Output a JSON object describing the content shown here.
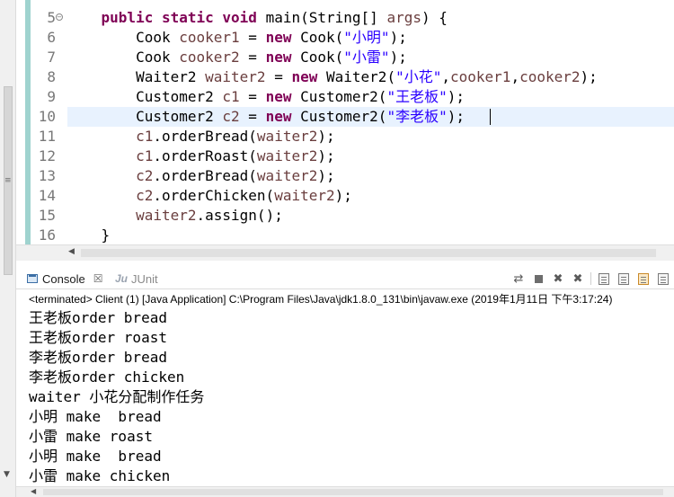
{
  "editor": {
    "lines": [
      {
        "n": "5",
        "tokens": [
          {
            "t": "    ",
            "c": ""
          },
          {
            "t": "public",
            "c": "kw"
          },
          {
            "t": " ",
            "c": ""
          },
          {
            "t": "static",
            "c": "kw"
          },
          {
            "t": " ",
            "c": ""
          },
          {
            "t": "void",
            "c": "kw"
          },
          {
            "t": " main(String[] ",
            "c": ""
          },
          {
            "t": "args",
            "c": "var"
          },
          {
            "t": ") {",
            "c": ""
          }
        ]
      },
      {
        "n": "6",
        "tokens": [
          {
            "t": "        Cook ",
            "c": ""
          },
          {
            "t": "cooker1",
            "c": "var"
          },
          {
            "t": " = ",
            "c": ""
          },
          {
            "t": "new",
            "c": "kw"
          },
          {
            "t": " Cook(",
            "c": ""
          },
          {
            "t": "\"小明\"",
            "c": "str"
          },
          {
            "t": ");",
            "c": ""
          }
        ]
      },
      {
        "n": "7",
        "tokens": [
          {
            "t": "        Cook ",
            "c": ""
          },
          {
            "t": "cooker2",
            "c": "var"
          },
          {
            "t": " = ",
            "c": ""
          },
          {
            "t": "new",
            "c": "kw"
          },
          {
            "t": " Cook(",
            "c": ""
          },
          {
            "t": "\"小雷\"",
            "c": "str"
          },
          {
            "t": ");",
            "c": ""
          }
        ]
      },
      {
        "n": "8",
        "tokens": [
          {
            "t": "        Waiter2 ",
            "c": ""
          },
          {
            "t": "waiter2",
            "c": "var"
          },
          {
            "t": " = ",
            "c": ""
          },
          {
            "t": "new",
            "c": "kw"
          },
          {
            "t": " Waiter2(",
            "c": ""
          },
          {
            "t": "\"小花\"",
            "c": "str"
          },
          {
            "t": ",",
            "c": ""
          },
          {
            "t": "cooker1",
            "c": "var"
          },
          {
            "t": ",",
            "c": ""
          },
          {
            "t": "cooker2",
            "c": "var"
          },
          {
            "t": ");",
            "c": ""
          }
        ]
      },
      {
        "n": "9",
        "tokens": [
          {
            "t": "        Customer2 ",
            "c": ""
          },
          {
            "t": "c1",
            "c": "var"
          },
          {
            "t": " = ",
            "c": ""
          },
          {
            "t": "new",
            "c": "kw"
          },
          {
            "t": " Customer2(",
            "c": ""
          },
          {
            "t": "\"王老板\"",
            "c": "str"
          },
          {
            "t": ");",
            "c": ""
          }
        ]
      },
      {
        "n": "10",
        "tokens": [
          {
            "t": "        Customer2 ",
            "c": ""
          },
          {
            "t": "c2",
            "c": "var"
          },
          {
            "t": " = ",
            "c": ""
          },
          {
            "t": "new",
            "c": "kw"
          },
          {
            "t": " Customer2(",
            "c": ""
          },
          {
            "t": "\"李老板\"",
            "c": "str"
          },
          {
            "t": ");",
            "c": ""
          }
        ]
      },
      {
        "n": "11",
        "tokens": [
          {
            "t": "        ",
            "c": ""
          },
          {
            "t": "c1",
            "c": "var"
          },
          {
            "t": ".orderBread(",
            "c": ""
          },
          {
            "t": "waiter2",
            "c": "var"
          },
          {
            "t": ");",
            "c": ""
          }
        ]
      },
      {
        "n": "12",
        "tokens": [
          {
            "t": "        ",
            "c": ""
          },
          {
            "t": "c1",
            "c": "var"
          },
          {
            "t": ".orderRoast(",
            "c": ""
          },
          {
            "t": "waiter2",
            "c": "var"
          },
          {
            "t": ");",
            "c": ""
          }
        ]
      },
      {
        "n": "13",
        "tokens": [
          {
            "t": "        ",
            "c": ""
          },
          {
            "t": "c2",
            "c": "var"
          },
          {
            "t": ".orderBread(",
            "c": ""
          },
          {
            "t": "waiter2",
            "c": "var"
          },
          {
            "t": ");",
            "c": ""
          }
        ]
      },
      {
        "n": "14",
        "tokens": [
          {
            "t": "        ",
            "c": ""
          },
          {
            "t": "c2",
            "c": "var"
          },
          {
            "t": ".orderChicken(",
            "c": ""
          },
          {
            "t": "waiter2",
            "c": "var"
          },
          {
            "t": ");",
            "c": ""
          }
        ]
      },
      {
        "n": "15",
        "tokens": [
          {
            "t": "        ",
            "c": ""
          },
          {
            "t": "waiter2",
            "c": "var"
          },
          {
            "t": ".assign();",
            "c": ""
          }
        ]
      },
      {
        "n": "16",
        "tokens": [
          {
            "t": "    }",
            "c": ""
          }
        ]
      }
    ]
  },
  "console": {
    "tab_label": "Console",
    "tab_close": "☒",
    "junit_label": "JUnit",
    "junit_glyph": "Ju",
    "status": "<terminated> Client (1) [Java Application] C:\\Program Files\\Java\\jdk1.8.0_131\\bin\\javaw.exe (2019年1月11日 下午3:17:24)",
    "output": [
      "王老板order bread",
      "王老板order roast",
      "李老板order bread",
      "李老板order chicken",
      "waiter 小花分配制作任务",
      "小明 make  bread",
      "小雷 make roast",
      "小明 make  bread",
      "小雷 make chicken"
    ]
  },
  "colors": {
    "keyword": "#7f0055",
    "string": "#2a00ff",
    "variable": "#6a3e3e",
    "line_number": "#787878",
    "current_line": "#e8f2fe",
    "ruler": "#9fd3cf"
  }
}
